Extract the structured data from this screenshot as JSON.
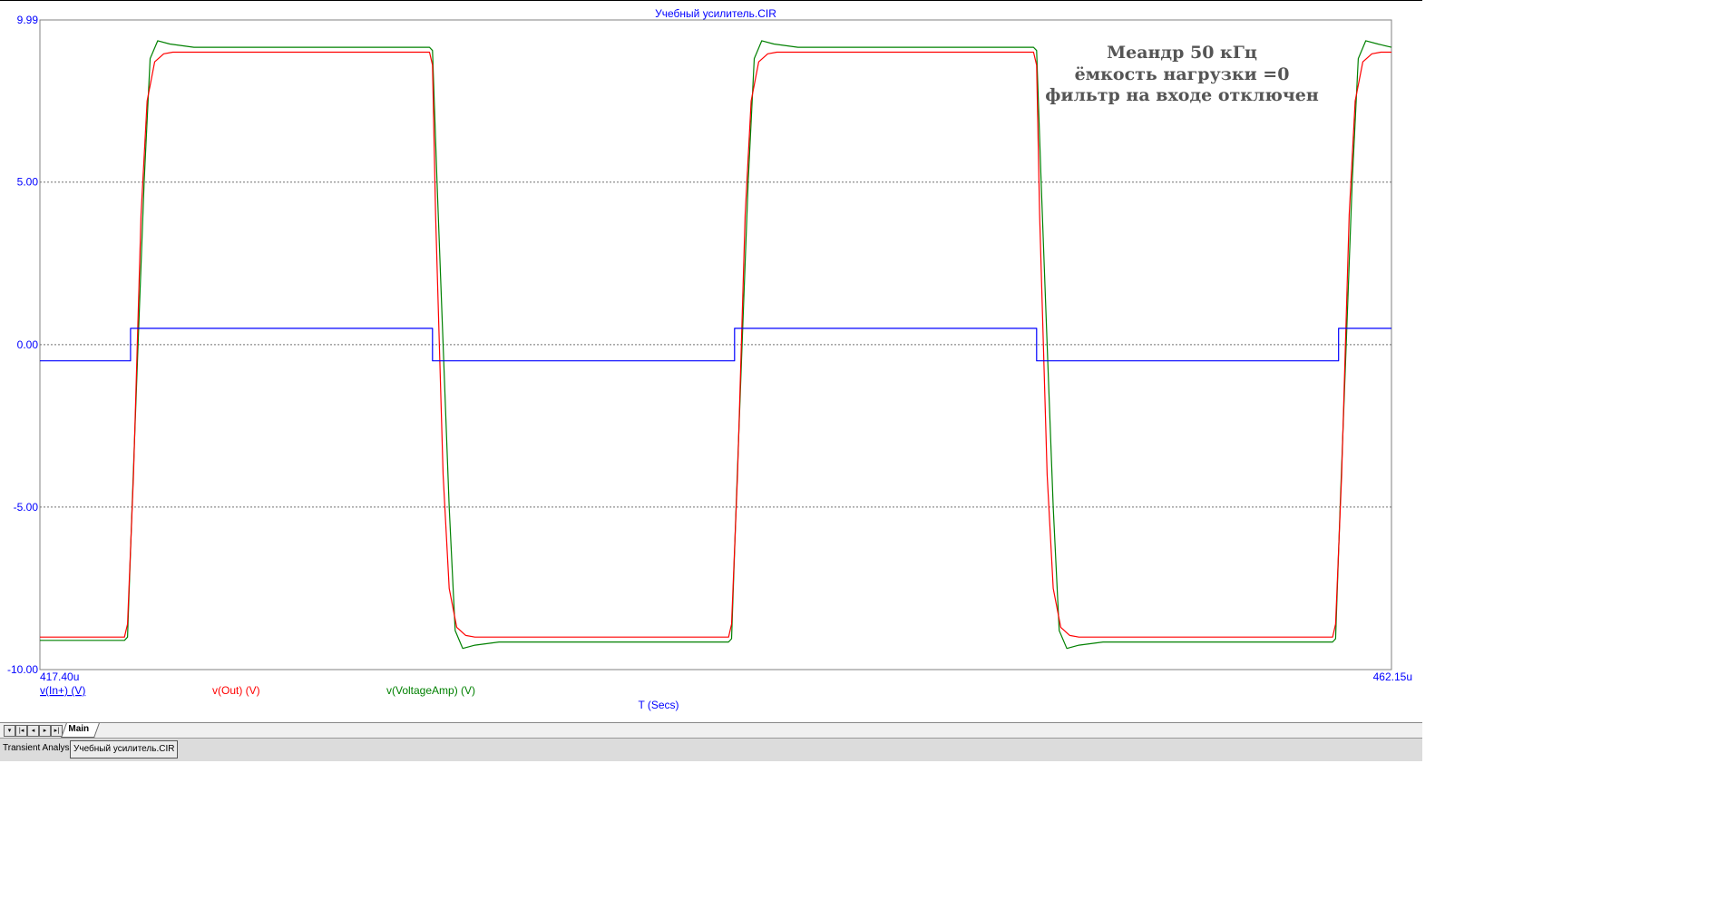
{
  "window": {
    "title": "Учебный усилитель.CIR"
  },
  "chart_data": {
    "type": "line",
    "title": "Учебный усилитель.CIR",
    "xlabel": "T (Secs)",
    "ylabel": "",
    "xlim": [
      417.4,
      462.15
    ],
    "x_unit": "us",
    "ylim": [
      -10.0,
      9.99
    ],
    "x_tick_labels": [
      "417.40u",
      "462.15u"
    ],
    "y_tick_labels": [
      "9.99",
      "5.00",
      "0.00",
      "-5.00",
      "-10.00"
    ],
    "y_ticks": [
      9.99,
      5.0,
      0.0,
      -5.0,
      -10.0
    ],
    "grid": "horizontal dotted",
    "annotation": [
      "Меандр 50 кГц",
      "ёмкость нагрузки =0",
      "фильтр на входе отключен"
    ],
    "series": [
      {
        "name": "v(In+) (V)",
        "color": "#0000ff",
        "x": [
          417.4,
          420.4,
          420.4,
          430.4,
          430.4,
          440.4,
          440.4,
          450.4,
          450.4,
          460.4,
          460.4,
          462.15
        ],
        "y": [
          -0.5,
          -0.5,
          0.5,
          0.5,
          -0.5,
          -0.5,
          0.5,
          0.5,
          -0.5,
          -0.5,
          0.5,
          0.5
        ]
      },
      {
        "name": "v(Out) (V)",
        "color": "#ff0000",
        "x": [
          417.4,
          420.2,
          420.3,
          420.5,
          420.75,
          420.95,
          421.2,
          421.5,
          421.8,
          430.3,
          430.4,
          430.5,
          430.75,
          430.95,
          431.2,
          431.5,
          431.8,
          440.2,
          440.3,
          440.5,
          440.75,
          440.95,
          441.2,
          441.5,
          441.8,
          450.3,
          450.4,
          450.5,
          450.75,
          450.95,
          451.2,
          451.5,
          451.8,
          460.2,
          460.3,
          460.5,
          460.75,
          460.95,
          461.2,
          461.5,
          461.8,
          462.15
        ],
        "y": [
          -9.0,
          -9.0,
          -8.6,
          -4.0,
          4.0,
          7.5,
          8.7,
          8.95,
          9.0,
          9.0,
          8.6,
          4.0,
          -4.0,
          -7.5,
          -8.7,
          -8.95,
          -9.0,
          -9.0,
          -8.6,
          -4.0,
          4.0,
          7.5,
          8.7,
          8.95,
          9.0,
          9.0,
          8.6,
          4.0,
          -4.0,
          -7.5,
          -8.7,
          -8.95,
          -9.0,
          -9.0,
          -8.6,
          -4.0,
          4.0,
          7.5,
          8.7,
          8.95,
          9.0,
          9.0
        ]
      },
      {
        "name": "v(VoltageAmp) (V)",
        "color": "#008000",
        "x": [
          417.4,
          420.2,
          420.3,
          420.45,
          420.65,
          420.85,
          421.05,
          421.3,
          421.7,
          422.5,
          430.3,
          430.4,
          430.55,
          430.75,
          430.95,
          431.15,
          431.4,
          431.8,
          432.6,
          440.2,
          440.3,
          440.45,
          440.65,
          440.85,
          441.05,
          441.3,
          441.7,
          442.5,
          450.3,
          450.4,
          450.55,
          450.75,
          450.95,
          451.15,
          451.4,
          451.8,
          452.6,
          460.2,
          460.3,
          460.45,
          460.65,
          460.85,
          461.05,
          461.3,
          461.7,
          462.15
        ],
        "y": [
          -9.1,
          -9.1,
          -9.0,
          -5.0,
          0.0,
          5.0,
          8.8,
          9.35,
          9.25,
          9.15,
          9.15,
          9.05,
          5.0,
          0.0,
          -5.0,
          -8.8,
          -9.35,
          -9.25,
          -9.15,
          -9.15,
          -9.05,
          -5.0,
          0.0,
          5.0,
          8.8,
          9.35,
          9.25,
          9.15,
          9.15,
          9.05,
          5.0,
          0.0,
          -5.0,
          -8.8,
          -9.35,
          -9.25,
          -9.15,
          -9.15,
          -9.05,
          -5.0,
          0.0,
          5.0,
          8.8,
          9.35,
          9.25,
          9.15
        ]
      }
    ]
  },
  "tabs": {
    "main_label": "Main",
    "nav_buttons": [
      "▾",
      "|◂",
      "◂",
      "▸",
      "▸|"
    ]
  },
  "status": {
    "analysis_tab": "Transient Analysis",
    "file_tab": "Учебный усилитель.CIR"
  }
}
